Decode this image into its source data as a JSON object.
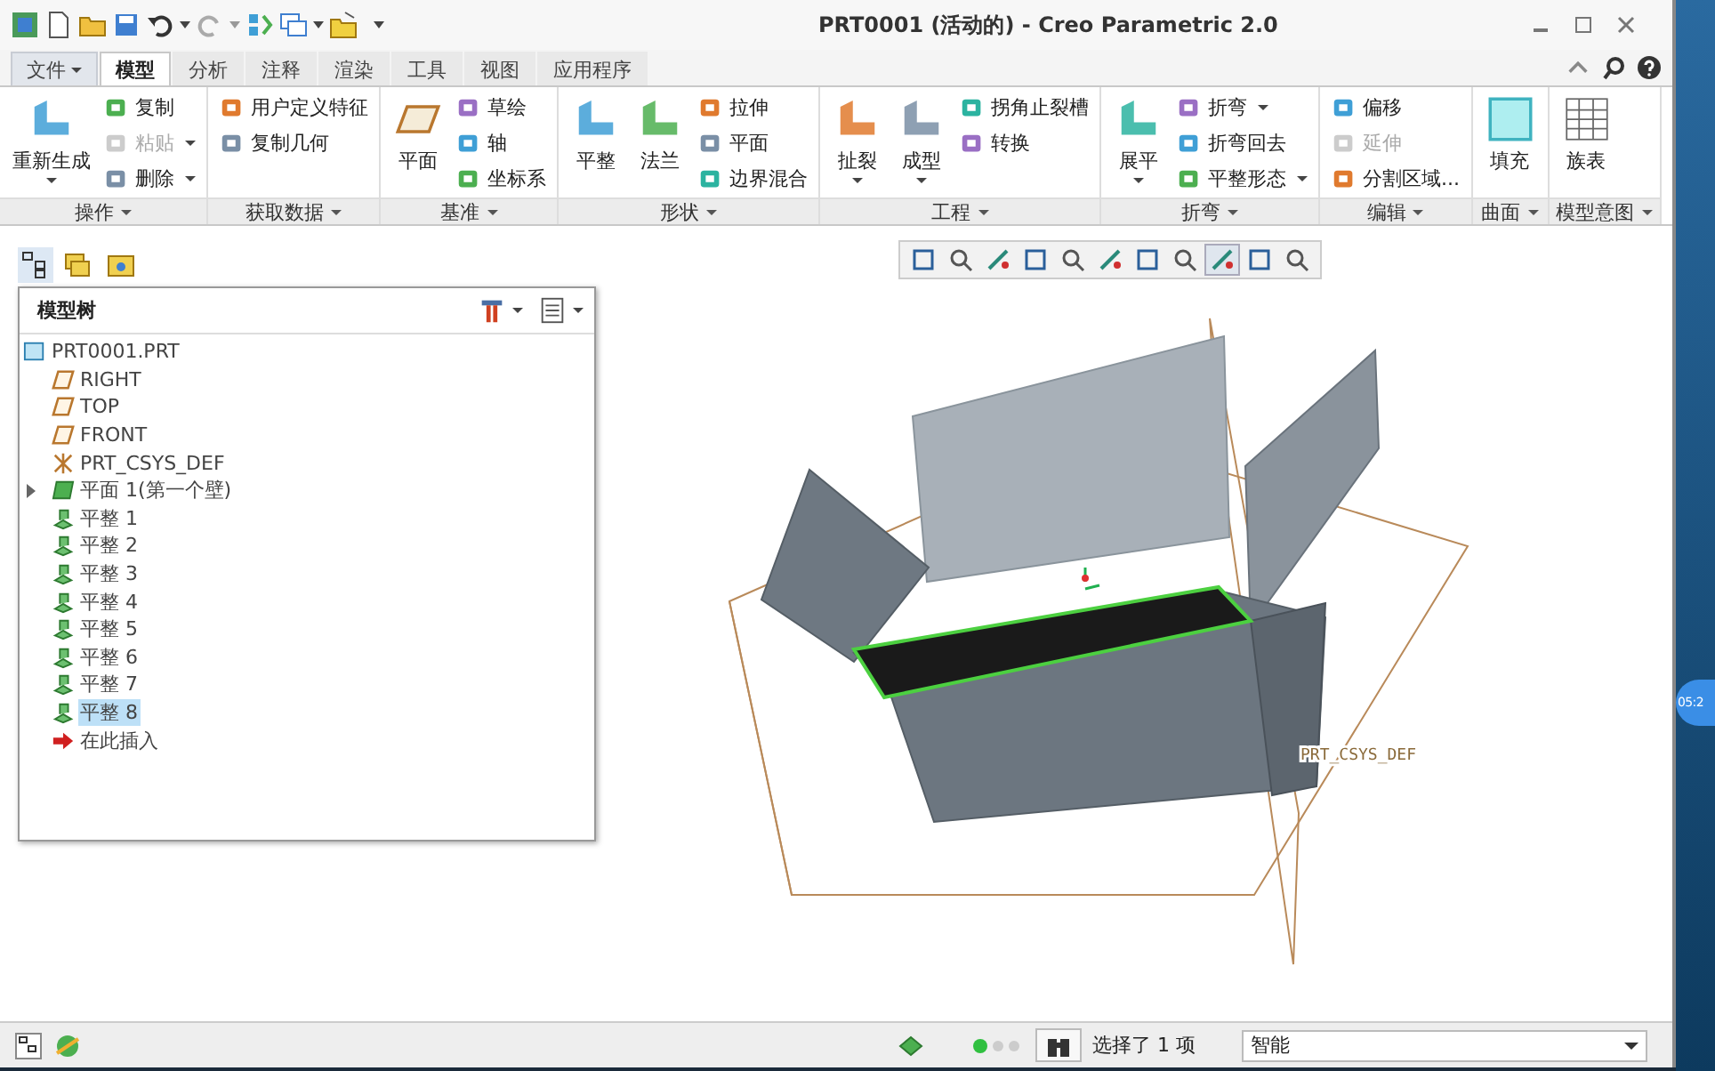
{
  "window": {
    "title": "PRT0001 (活动的) - Creo Parametric 2.0"
  },
  "tabs": [
    {
      "label": "文件",
      "kind": "menu",
      "selected": false
    },
    {
      "label": "模型",
      "kind": "tab",
      "selected": true
    },
    {
      "label": "分析",
      "kind": "tab",
      "selected": false
    },
    {
      "label": "注释",
      "kind": "tab",
      "selected": false
    },
    {
      "label": "渲染",
      "kind": "tab",
      "selected": false
    },
    {
      "label": "工具",
      "kind": "tab",
      "selected": false
    },
    {
      "label": "视图",
      "kind": "tab",
      "selected": false
    },
    {
      "label": "应用程序",
      "kind": "tab",
      "selected": false
    }
  ],
  "ribbon": {
    "groups": [
      {
        "label": "操作",
        "items": [
          {
            "label": "重新生成",
            "kind": "large",
            "dropdown": true,
            "disabled": false
          },
          {
            "label": "复制",
            "kind": "small",
            "dropdown": false,
            "disabled": false
          },
          {
            "label": "粘贴",
            "kind": "small",
            "dropdown": true,
            "disabled": true
          },
          {
            "label": "删除",
            "kind": "small",
            "dropdown": true,
            "disabled": false
          }
        ]
      },
      {
        "label": "获取数据",
        "items": [
          {
            "label": "用户定义特征",
            "kind": "small",
            "dropdown": false,
            "disabled": false
          },
          {
            "label": "复制几何",
            "kind": "small",
            "dropdown": false,
            "disabled": false
          }
        ]
      },
      {
        "label": "基准",
        "items": [
          {
            "label": "平面",
            "kind": "large",
            "dropdown": false,
            "disabled": false
          },
          {
            "label": "草绘",
            "kind": "small",
            "dropdown": false,
            "disabled": false
          },
          {
            "label": "轴",
            "kind": "small",
            "dropdown": false,
            "disabled": false
          },
          {
            "label": "坐标系",
            "kind": "small",
            "dropdown": false,
            "disabled": false
          }
        ]
      },
      {
        "label": "形状",
        "items": [
          {
            "label": "平整",
            "kind": "large",
            "dropdown": false,
            "disabled": false
          },
          {
            "label": "法兰",
            "kind": "large",
            "dropdown": false,
            "disabled": false
          },
          {
            "label": "拉伸",
            "kind": "small",
            "dropdown": false,
            "disabled": false
          },
          {
            "label": "平面",
            "kind": "small",
            "dropdown": false,
            "disabled": false
          },
          {
            "label": "边界混合",
            "kind": "small",
            "dropdown": false,
            "disabled": false
          }
        ]
      },
      {
        "label": "工程",
        "items": [
          {
            "label": "扯裂",
            "kind": "large",
            "dropdown": true,
            "disabled": false
          },
          {
            "label": "成型",
            "kind": "large",
            "dropdown": true,
            "disabled": false
          },
          {
            "label": "拐角止裂槽",
            "kind": "small",
            "dropdown": false,
            "disabled": false
          },
          {
            "label": "转换",
            "kind": "small",
            "dropdown": false,
            "disabled": false
          }
        ]
      },
      {
        "label": "折弯",
        "items": [
          {
            "label": "展平",
            "kind": "large",
            "dropdown": true,
            "disabled": false
          },
          {
            "label": "折弯",
            "kind": "small",
            "dropdown": true,
            "disabled": false
          },
          {
            "label": "折弯回去",
            "kind": "small",
            "dropdown": false,
            "disabled": false
          },
          {
            "label": "平整形态",
            "kind": "small",
            "dropdown": true,
            "disabled": false
          }
        ]
      },
      {
        "label": "编辑",
        "items": [
          {
            "label": "偏移",
            "kind": "small",
            "dropdown": false,
            "disabled": false
          },
          {
            "label": "延伸",
            "kind": "small",
            "dropdown": false,
            "disabled": true
          },
          {
            "label": "分割区域...",
            "kind": "small",
            "dropdown": false,
            "disabled": false
          }
        ]
      },
      {
        "label": "曲面",
        "items": [
          {
            "label": "填充",
            "kind": "large",
            "dropdown": false,
            "disabled": false
          }
        ]
      },
      {
        "label": "模型意图",
        "items": [
          {
            "label": "族表",
            "kind": "large",
            "dropdown": false,
            "disabled": false
          }
        ]
      }
    ]
  },
  "view_toolbar": [
    {
      "selected": false
    },
    {
      "selected": false
    },
    {
      "selected": false
    },
    {
      "selected": false
    },
    {
      "selected": false
    },
    {
      "selected": false
    },
    {
      "selected": false
    },
    {
      "selected": false
    },
    {
      "selected": true
    },
    {
      "selected": false
    },
    {
      "selected": false
    }
  ],
  "model_tree": {
    "title": "模型树",
    "root": {
      "label": "PRT0001.PRT",
      "kind": "part",
      "selected": false,
      "children": [
        {
          "label": "RIGHT",
          "kind": "datum-plane",
          "selected": false
        },
        {
          "label": "TOP",
          "kind": "datum-plane",
          "selected": false
        },
        {
          "label": "FRONT",
          "kind": "datum-plane",
          "selected": false
        },
        {
          "label": "PRT_CSYS_DEF",
          "kind": "csys",
          "selected": false
        },
        {
          "label": "平面 1(第一个壁)",
          "kind": "wall",
          "selected": false,
          "expanded": false
        },
        {
          "label": "平整 1",
          "kind": "flat",
          "selected": false
        },
        {
          "label": "平整 2",
          "kind": "flat",
          "selected": false
        },
        {
          "label": "平整 3",
          "kind": "flat",
          "selected": false
        },
        {
          "label": "平整 4",
          "kind": "flat",
          "selected": false
        },
        {
          "label": "平整 5",
          "kind": "flat",
          "selected": false
        },
        {
          "label": "平整 6",
          "kind": "flat",
          "selected": false
        },
        {
          "label": "平整 7",
          "kind": "flat",
          "selected": false
        },
        {
          "label": "平整 8",
          "kind": "flat",
          "selected": true
        },
        {
          "label": "在此插入",
          "kind": "insert",
          "selected": false
        }
      ]
    }
  },
  "graphics": {
    "csys_label": "PRT_CSYS_DEF"
  },
  "status_bar": {
    "selection": "选择了 1 项",
    "filter": "智能"
  },
  "desktop": {
    "clock": "05:2"
  }
}
